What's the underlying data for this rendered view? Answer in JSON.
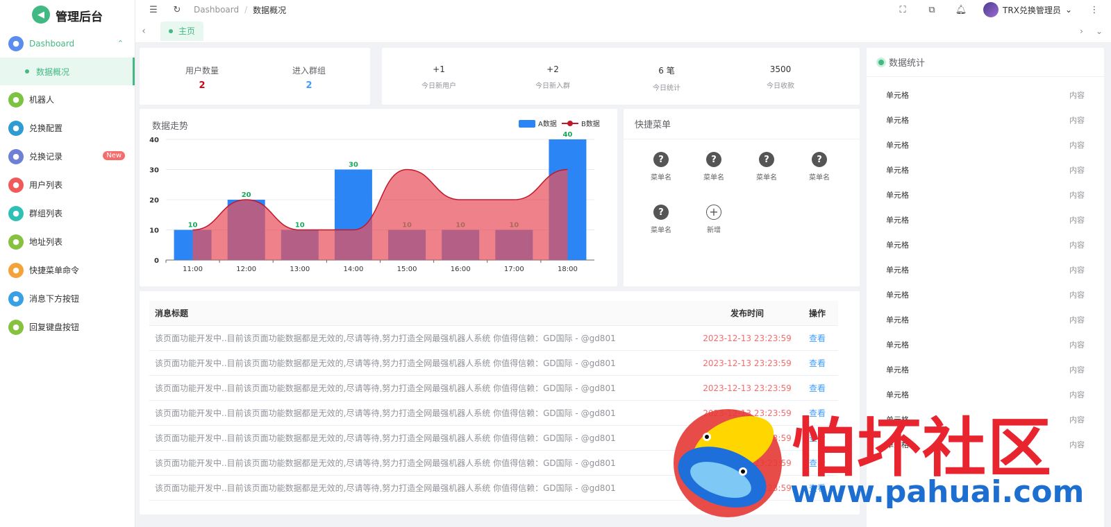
{
  "app": {
    "title": "管理后台"
  },
  "sidebar": {
    "items": [
      {
        "label": "Dashboard",
        "icon": "home-icon",
        "color": "#5a8dee"
      },
      {
        "label": "数据概况"
      },
      {
        "label": "机器人",
        "icon": "monitor-icon",
        "color": "#7cc342"
      },
      {
        "label": "兑换配置",
        "icon": "settings-icon",
        "color": "#2f9bd4"
      },
      {
        "label": "兑换记录",
        "icon": "document-icon",
        "color": "#6e7fd6",
        "badge": "New"
      },
      {
        "label": "用户列表",
        "icon": "user-icon",
        "color": "#f05a5a"
      },
      {
        "label": "群组列表",
        "icon": "group-icon",
        "color": "#2fc0b5"
      },
      {
        "label": "地址列表",
        "icon": "location-icon",
        "color": "#86c240"
      },
      {
        "label": "快捷菜单命令",
        "icon": "menu-icon",
        "color": "#f3a33a"
      },
      {
        "label": "消息下方按钮",
        "icon": "button-icon",
        "color": "#3aa0e6"
      },
      {
        "label": "回复键盘按钮",
        "icon": "keyboard-icon",
        "color": "#86c240"
      }
    ]
  },
  "topbar": {
    "breadcrumb": [
      "Dashboard",
      "数据概况"
    ],
    "user": "TRX兑换管理员"
  },
  "tabs": [
    {
      "label": "主页"
    }
  ],
  "stats1": {
    "user_count_label": "用户数量",
    "user_count": "2",
    "group_label": "进入群组",
    "group_count": "2"
  },
  "stats2": [
    {
      "value": "+1",
      "label": "今日新用户"
    },
    {
      "value": "+2",
      "label": "今日新入群"
    },
    {
      "value": "6 笔",
      "label": "今日统计"
    },
    {
      "value": "3500",
      "label": "今日收款"
    }
  ],
  "chart_card": {
    "title": "数据走势"
  },
  "quick_menu": {
    "title": "快捷菜单",
    "items": [
      "菜单名",
      "菜单名",
      "菜单名",
      "菜单名",
      "菜单名"
    ],
    "add_label": "新增"
  },
  "messages": {
    "headers": {
      "title": "消息标题",
      "time": "发布时间",
      "op": "操作"
    },
    "rows": [
      {
        "title": "该页面功能开发中..目前该页面功能数据都是无效的,尽请等待,努力打造全网最强机器人系统 你值得信赖：GD国际 - @gd801",
        "time": "2023-12-13 23:23:59",
        "op": "查看"
      },
      {
        "title": "该页面功能开发中..目前该页面功能数据都是无效的,尽请等待,努力打造全网最强机器人系统 你值得信赖：GD国际 - @gd801",
        "time": "2023-12-13 23:23:59",
        "op": "查看"
      },
      {
        "title": "该页面功能开发中..目前该页面功能数据都是无效的,尽请等待,努力打造全网最强机器人系统 你值得信赖：GD国际 - @gd801",
        "time": "2023-12-13 23:23:59",
        "op": "查看"
      },
      {
        "title": "该页面功能开发中..目前该页面功能数据都是无效的,尽请等待,努力打造全网最强机器人系统 你值得信赖：GD国际 - @gd801",
        "time": "2023-12-13 23:23:59",
        "op": "查看"
      },
      {
        "title": "该页面功能开发中..目前该页面功能数据都是无效的,尽请等待,努力打造全网最强机器人系统 你值得信赖：GD国际 - @gd801",
        "time": "2023-12-13 23:23:59",
        "op": "查看"
      },
      {
        "title": "该页面功能开发中..目前该页面功能数据都是无效的,尽请等待,努力打造全网最强机器人系统 你值得信赖：GD国际 - @gd801",
        "time": "2023-12-13 23:23:59",
        "op": "查看"
      },
      {
        "title": "该页面功能开发中..目前该页面功能数据都是无效的,尽请等待,努力打造全网最强机器人系统 你值得信赖：GD国际 - @gd801",
        "time": "2023-12-13 23:23:59",
        "op": "查看"
      }
    ]
  },
  "data_stats": {
    "title": "数据统计",
    "rows": [
      {
        "key": "单元格",
        "value": "内容"
      },
      {
        "key": "单元格",
        "value": "内容"
      },
      {
        "key": "单元格",
        "value": "内容"
      },
      {
        "key": "单元格",
        "value": "内容"
      },
      {
        "key": "单元格",
        "value": "内容"
      },
      {
        "key": "单元格",
        "value": "内容"
      },
      {
        "key": "单元格",
        "value": "内容"
      },
      {
        "key": "单元格",
        "value": "内容"
      },
      {
        "key": "单元格",
        "value": "内容"
      },
      {
        "key": "单元格",
        "value": "内容"
      },
      {
        "key": "单元格",
        "value": "内容"
      },
      {
        "key": "单元格",
        "value": "内容"
      },
      {
        "key": "单元格",
        "value": "内容"
      },
      {
        "key": "单元格",
        "value": "内容"
      },
      {
        "key": "单元格",
        "value": "内容"
      }
    ]
  },
  "watermark": {
    "text": "怕坏社区",
    "url": "www.pahuai.com"
  },
  "colors": {
    "accent": "#42b983",
    "bar_a": "#2b85f5",
    "area_b": "#e8505b",
    "danger": "#f56c6c",
    "link": "#409eff"
  },
  "chart_data": {
    "type": "bar",
    "categories": [
      "11:00",
      "12:00",
      "13:00",
      "14:00",
      "15:00",
      "16:00",
      "17:00",
      "18:00"
    ],
    "series": [
      {
        "name": "A数据",
        "type": "bar",
        "values": [
          10,
          20,
          10,
          30,
          10,
          10,
          10,
          40
        ]
      },
      {
        "name": "B数据",
        "type": "area",
        "values": [
          10,
          20,
          10,
          10,
          30,
          20,
          20,
          30
        ]
      }
    ],
    "ylim": [
      0,
      40
    ],
    "yticks": [
      0,
      10,
      20,
      30,
      40
    ],
    "legend": "top-right",
    "grid": true
  }
}
